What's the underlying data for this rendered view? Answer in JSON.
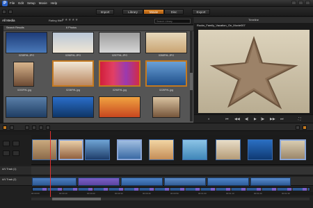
{
  "window": {
    "menu": [
      "File",
      "Edit",
      "Setup",
      "Movie",
      "Help"
    ]
  },
  "modes": {
    "import": "Import",
    "library": "Library",
    "movie": "Movie",
    "disc": "Disc",
    "export": "Export"
  },
  "library": {
    "all_media": "All Media",
    "rating_filter_label": "Rating filter",
    "section_title": "Search Results",
    "subheader": "6 Photos",
    "search_placeholder": "Search Library",
    "items": [
      {
        "label": "0238FHL.JPG"
      },
      {
        "label": "0298FHL.JPG"
      },
      {
        "label": "0257FHL.JPG"
      },
      {
        "label": "0268FHL.JPG"
      },
      {
        "label": "0203FHL.jpg"
      },
      {
        "label": "0236FHL.jpg"
      },
      {
        "label": "0296FHL.jpg"
      },
      {
        "label": "0228FHL.jpg"
      },
      {
        "label": "0231FHL.jpg"
      },
      {
        "label": "0232FHL.jpg"
      },
      {
        "label": "0233FHL.jpg"
      },
      {
        "label": "0234FHL.jpg"
      }
    ]
  },
  "preview": {
    "header": "Timeline",
    "filename": "Rocks_Family_Vacation_On_Movie007"
  },
  "timeline": {
    "track_av1": "A/V Track (1)",
    "track_av2": "A/V Track (2)",
    "ruler_marks": [
      "00:00:00",
      "00:00:10",
      "00:00:20",
      "00:00:30",
      "00:00:40",
      "00:00:50",
      "00:01:00",
      "00:01:10",
      "00:01:20",
      "00:01:30"
    ]
  },
  "colors": {
    "accent": "#c47a20",
    "clip_blue": "#3d6aa8",
    "background": "#252525"
  }
}
